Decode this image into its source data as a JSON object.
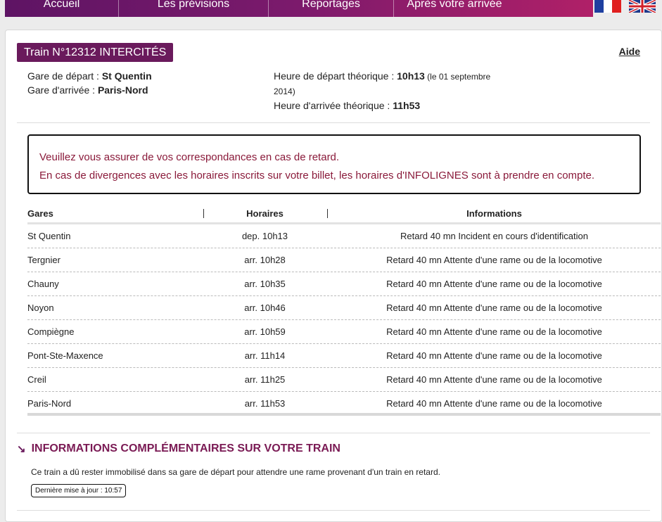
{
  "nav": {
    "items": [
      "Accueil",
      "Les prévisions",
      "Reportages",
      "Après votre arrivée"
    ],
    "colors": {
      "from": "#5e1464",
      "to": "#b02068"
    }
  },
  "flags": [
    "fr-flag-icon",
    "uk-flag-icon"
  ],
  "train": {
    "title": "Train N°12312 INTERCITÉS",
    "help": "Aide",
    "departure_label": "Gare de départ : ",
    "departure_station": "St Quentin",
    "arrival_label": "Gare d'arrivée : ",
    "arrival_station": "Paris-Nord",
    "dep_time_label": "Heure de départ théorique : ",
    "dep_time": "10h13",
    "dep_date_a": " (le 01 septembre",
    "dep_date_b": "2014)",
    "arr_time_label": "Heure d'arrivée théorique : ",
    "arr_time": "11h53"
  },
  "warning": {
    "line1": "Veuillez vous assurer de vos correspondances en cas de retard.",
    "line2": "En cas de divergences avec les horaires inscrits sur votre billet, les horaires d'INFOLIGNES sont à prendre en compte."
  },
  "table": {
    "headers": [
      "Gares",
      "Horaires",
      "Informations"
    ],
    "rows": [
      [
        "St Quentin",
        "dep. 10h13",
        "Retard 40 mn Incident en cours d'identification"
      ],
      [
        "Tergnier",
        "arr. 10h28",
        "Retard 40 mn Attente d'une rame ou de la locomotive"
      ],
      [
        "Chauny",
        "arr. 10h35",
        "Retard 40 mn Attente d'une rame ou de la locomotive"
      ],
      [
        "Noyon",
        "arr. 10h46",
        "Retard 40 mn Attente d'une rame ou de la locomotive"
      ],
      [
        "Compiègne",
        "arr. 10h59",
        "Retard 40 mn Attente d'une rame ou de la locomotive"
      ],
      [
        "Pont-Ste-Maxence",
        "arr. 11h14",
        "Retard 40 mn Attente d'une rame ou de la locomotive"
      ],
      [
        "Creil",
        "arr. 11h25",
        "Retard 40 mn Attente d'une rame ou de la locomotive"
      ],
      [
        "Paris-Nord",
        "arr. 11h53",
        "Retard 40 mn Attente d'une rame ou de la locomotive"
      ]
    ]
  },
  "complement": {
    "title": "INFORMATIONS COMPLÉMENTAIRES SUR VOTRE TRAIN",
    "text": "Ce train a dû rester immobilisé dans sa gare de départ pour attendre une rame provenant d'un train en retard.",
    "update": "Dernière mise à jour : 10:57"
  }
}
